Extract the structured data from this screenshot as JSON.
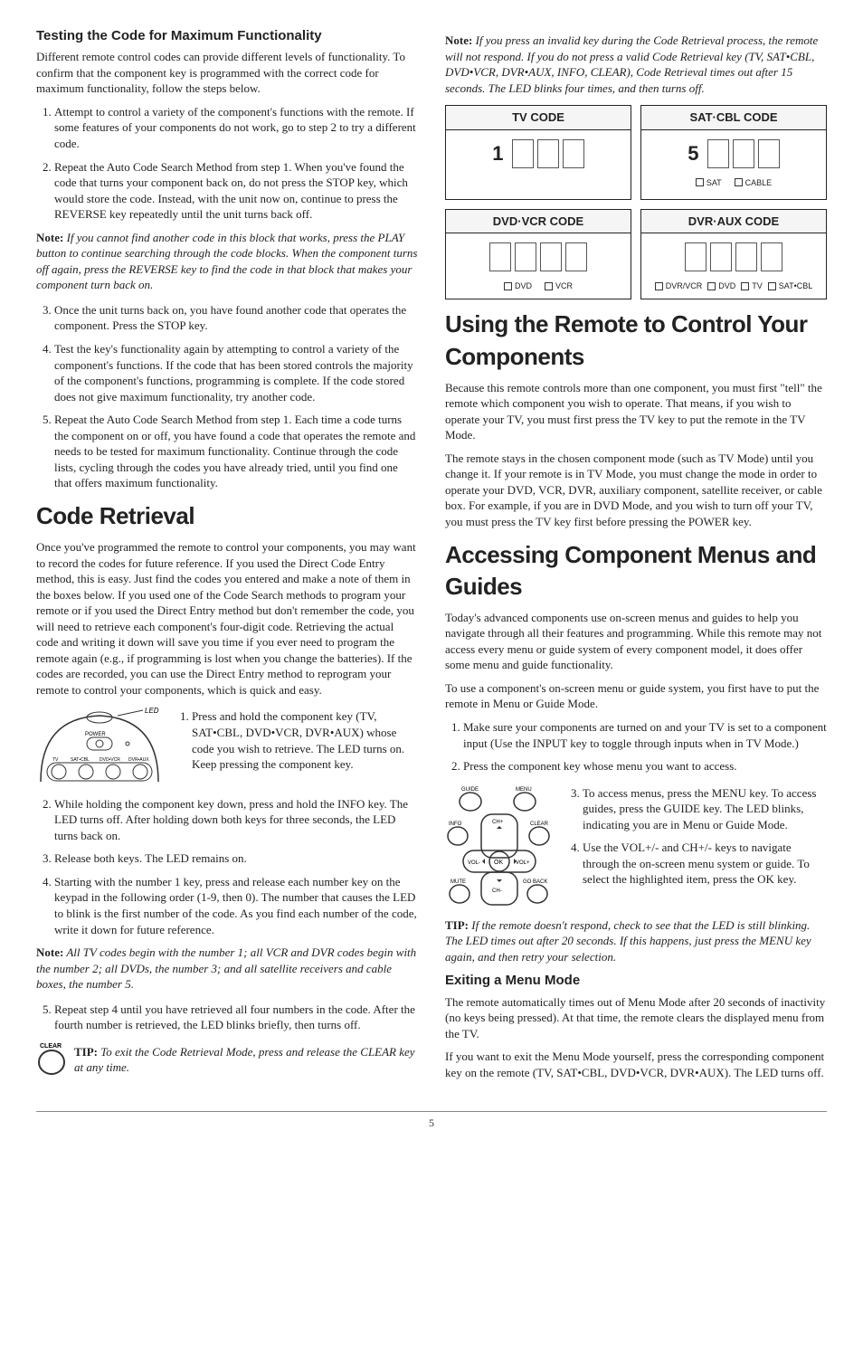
{
  "left": {
    "h_testing": "Testing the Code for Maximum Functionality",
    "p_testing1": "Different remote control codes can provide different levels of functionality. To confirm that the component key is programmed with the correct code for maximum functionality, follow the steps below.",
    "testing_steps": [
      "Attempt to control a variety of the component's functions with the remote. If some features of your components do not work, go to step 2 to try a different code.",
      "Repeat the Auto Code Search Method from step 1. When you've found the code that turns your component back on, do not press the STOP key, which would store the code. Instead, with the unit now on, continue to press the REVERSE key repeatedly until the unit turns back off."
    ],
    "note_testing": "If you cannot find another code in this block that works, press the PLAY button to continue searching through the code blocks. When the component turns off again, press the REVERSE key to find the code in that block that makes your component turn back on.",
    "testing_steps2": [
      "Once the unit turns back on, you have found another code that operates the component. Press the STOP key.",
      "Test the key's functionality again by attempting to control a variety of the component's functions. If the code that has been stored controls the majority of the component's functions, programming is complete. If the code stored does not give maximum functionality, try another code.",
      "Repeat the Auto Code Search Method from step 1. Each time a code turns the component on or off, you have found a code that operates the remote and needs to be tested for maximum functionality. Continue through the code lists, cycling through the codes you have already tried, until you find one that offers maximum functionality."
    ],
    "h_code": "Code Retrieval",
    "p_code1": "Once you've programmed the remote to control your components, you may want to record the codes for future reference. If you used the Direct Code Entry method, this is easy. Just find the codes you entered and make a note of them in the boxes below. If you used one of the Code Search methods to program your remote or if you used the Direct Entry method but don't remember the code, you will need to retrieve each component's four-digit code. Retrieving the actual code and writing it down will save you time if you ever need to program the remote again (e.g., if programming is lost when you change the batteries). If the codes are recorded, you can use the Direct Entry method to reprogram your remote to control your components, which is quick and easy.",
    "led_label": "LED",
    "remote_labels": {
      "power": "POWER",
      "tv": "TV",
      "satcbl": "SAT•CBL",
      "dvdvcr": "DVD•VCR",
      "dvraux": "DVR•AUX"
    },
    "code_step1": "Press and hold the component key (TV, SAT•CBL, DVD•VCR, DVR•AUX) whose code you wish to retrieve. The LED turns on. Keep pressing the component key.",
    "code_steps_rest": [
      "While holding the component key down, press and hold the INFO key. The LED turns off. After holding down both keys for three seconds, the LED turns back on.",
      "Release both keys. The LED remains on.",
      "Starting with the number 1 key, press and release each number key on the keypad in the following order (1-9, then 0). The number that causes the LED to blink is the first number of the code. As you find each number of the code, write it down for future reference."
    ],
    "note_code": "All TV codes begin with the number 1; all VCR and DVR codes begin with the number 2; all DVDs, the number 3; and all satellite receivers and cable boxes, the number 5.",
    "code_step5": "Repeat step 4 until you have retrieved all four numbers in the code. After the fourth number is retrieved, the LED blinks briefly, then turns off.",
    "clear_label": "CLEAR",
    "tip_code": "To exit the Code Retrieval Mode, press and release the CLEAR key at any time."
  },
  "right": {
    "note_top": "If you press an invalid key during the Code Retrieval process, the remote will not respond. If you do not press a valid Code Retrieval key (TV, SAT•CBL, DVD•VCR, DVR•AUX, INFO, CLEAR), Code Retrieval times out after 15 seconds. The LED blinks four times, and then turns off.",
    "boxes": {
      "tv": {
        "title": "TV CODE",
        "lead": "1"
      },
      "sat": {
        "title": "SAT·CBL CODE",
        "lead": "5",
        "labels": [
          "SAT",
          "CABLE"
        ]
      },
      "dvd": {
        "title": "DVD·VCR CODE",
        "labels": [
          "DVD",
          "VCR"
        ]
      },
      "dvr": {
        "title": "DVR·AUX CODE",
        "labels": [
          "DVR/VCR",
          "DVD",
          "TV",
          "SAT•CBL"
        ]
      }
    },
    "h_using": "Using the Remote to Control Your Components",
    "p_using1": "Because this remote controls more than one component, you must first \"tell\" the remote which component you wish to operate. That means, if you wish to operate your TV, you must first press the TV key to put the remote in the TV Mode.",
    "p_using2": "The remote stays in the chosen component mode (such as TV Mode) until you change it. If your remote is in TV Mode, you must change the mode in order to operate your DVD, VCR, DVR, auxiliary component, satellite receiver, or cable box. For example, if you are in DVD Mode, and you wish to turn off your TV, you must press the TV key first before pressing the POWER key.",
    "h_access": "Accessing Component Menus and Guides",
    "p_access1": "Today's advanced components use on-screen menus and guides to help you navigate through all their features and programming. While this remote may not access every menu or guide system of every component model, it does offer some menu and guide functionality.",
    "p_access2": "To use a component's on-screen menu or guide system, you first have to put the remote in Menu or Guide Mode.",
    "access_steps12": [
      "Make sure your components are turned on and your TV is set to a component input (Use the INPUT key to toggle through inputs when in TV Mode.)",
      "Press the component key whose menu you want to access."
    ],
    "nav_labels": {
      "guide": "GUIDE",
      "menu": "MENU",
      "info": "INFO",
      "clear": "CLEAR",
      "ch": "CH+",
      "ok": "OK",
      "vol_l": "VOL-",
      "vol_r": "VOL+",
      "mute": "MUTE",
      "goback": "GO BACK",
      "chm": "CH-"
    },
    "access_step3": "To access menus, press the MENU key. To access guides, press the GUIDE key. The LED blinks, indicating you are in Menu or Guide Mode.",
    "access_step4": "Use the VOL+/- and CH+/- keys to navigate through the on-screen menu system or guide. To select the highlighted item, press the OK key.",
    "tip_access": "If the remote doesn't respond, check to see that the LED is still blinking. The LED times out after 20 seconds. If this happens, just press the MENU key again, and then retry your selection.",
    "h_exit": "Exiting a Menu Mode",
    "p_exit1": "The remote automatically times out of Menu Mode after 20 seconds of inactivity (no keys being pressed). At that time, the remote clears the displayed menu from the TV.",
    "p_exit2": "If you want to exit the Menu Mode yourself, press the corresponding component key on the remote (TV, SAT•CBL, DVD•VCR, DVR•AUX). The LED turns off."
  },
  "note_label": "Note:",
  "tip_label": "TIP:",
  "page": "5"
}
